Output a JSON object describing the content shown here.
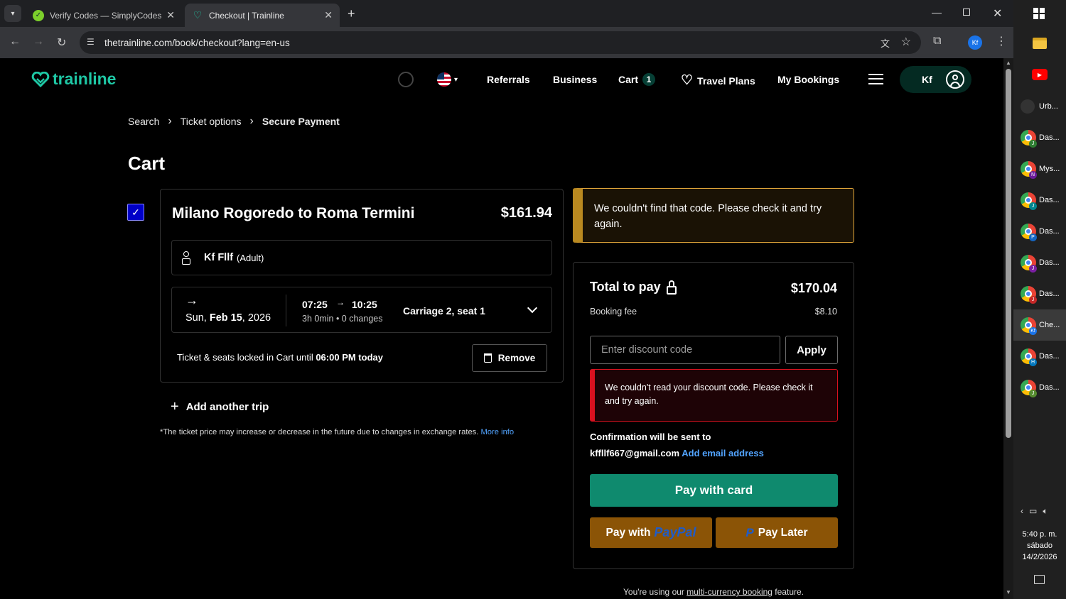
{
  "browser": {
    "tabs": [
      {
        "title": "Verify Codes — SimplyCodes",
        "active": false
      },
      {
        "title": "Checkout | Trainline",
        "active": true
      }
    ],
    "url": "thetrainline.com/book/checkout?lang=en-us",
    "profile_initials": "Kf"
  },
  "header": {
    "logo": "trainline",
    "nav": {
      "referrals": "Referrals",
      "business": "Business",
      "cart": "Cart",
      "cart_count": "1",
      "travel_plans": "Travel Plans",
      "my_bookings": "My Bookings"
    },
    "account_initials": "Kf"
  },
  "breadcrumb": [
    "Search",
    "Ticket options",
    "Secure Payment"
  ],
  "page_title": "Cart",
  "trip": {
    "route": "Milano Rogoredo to Roma Termini",
    "price": "$161.94",
    "passenger": "Kf Fllf",
    "passenger_type": "(Adult)",
    "date_prefix": "Sun, ",
    "date_bold": "Feb 15",
    "date_suffix": ", 2026",
    "depart": "07:25",
    "arrive": "10:25",
    "duration": "3h 0min • 0 changes",
    "seat": "Carriage 2, seat 1",
    "locked_text": "Ticket & seats locked in Cart until ",
    "locked_time": "06:00 PM today",
    "remove_label": "Remove"
  },
  "add_trip_label": "Add another trip",
  "disclaimer": "*The ticket price may increase or decrease in the future due to changes in exchange rates.",
  "disclaimer_link": "More info",
  "summary": {
    "code_alert": "We couldn't find that code. Please check it and try again.",
    "total_label": "Total to pay",
    "total_value": "$170.04",
    "fee_label": "Booking fee",
    "fee_value": "$8.10",
    "discount_placeholder": "Enter discount code",
    "apply_label": "Apply",
    "read_alert": "We couldn't read your discount code. Please check it and try again.",
    "confirm_label": "Confirmation will be sent to",
    "email": "kffllf667@gmail.com",
    "add_email": "Add email address",
    "pay_card": "Pay with card",
    "pay_with": "Pay with",
    "paypal": "PayPal",
    "pay_later": "Pay Later"
  },
  "footer_note": {
    "prefix": "You're using our ",
    "link": "multi-currency booking",
    "suffix": " feature."
  },
  "taskbar": {
    "items": [
      {
        "label": "Urb...",
        "badge": ""
      },
      {
        "label": "Das...",
        "badge": "J"
      },
      {
        "label": "Mys...",
        "badge": "N"
      },
      {
        "label": "Das...",
        "badge": "J"
      },
      {
        "label": "Das...",
        "badge": "P"
      },
      {
        "label": "Das...",
        "badge": "J"
      },
      {
        "label": "Das...",
        "badge": "J"
      },
      {
        "label": "Che...",
        "badge": "Kf"
      },
      {
        "label": "Das...",
        "badge": "H"
      },
      {
        "label": "Das...",
        "badge": "J"
      }
    ],
    "time": "5:40 p. m.",
    "day": "sábado",
    "date": "14/2/2026"
  }
}
